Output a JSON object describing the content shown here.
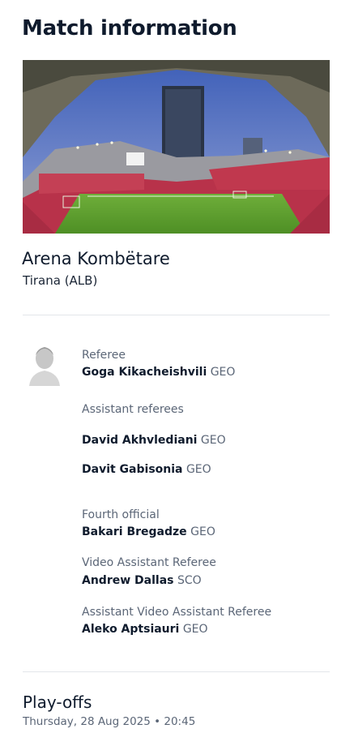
{
  "header": {
    "title": "Match information"
  },
  "venue": {
    "name": "Arena Kombëtare",
    "city": "Tirana (ALB)"
  },
  "officials": {
    "referee_label": "Referee",
    "referee": {
      "name": "Goga Kikacheishvili",
      "nat": "GEO"
    },
    "assistants_label": "Assistant referees",
    "assistants": [
      {
        "name": "David Akhvlediani",
        "nat": "GEO"
      },
      {
        "name": "Davit Gabisonia",
        "nat": "GEO"
      }
    ],
    "fourth_label": "Fourth official",
    "fourth": {
      "name": "Bakari Bregadze",
      "nat": "GEO"
    },
    "var_label": "Video Assistant Referee",
    "var": {
      "name": "Andrew Dallas",
      "nat": "SCO"
    },
    "avar_label": "Assistant Video Assistant Referee",
    "avar": {
      "name": "Aleko Aptsiauri",
      "nat": "GEO"
    }
  },
  "match": {
    "stage": "Play-offs",
    "datetime": "Thursday, 28 Aug 2025 • 20:45"
  }
}
